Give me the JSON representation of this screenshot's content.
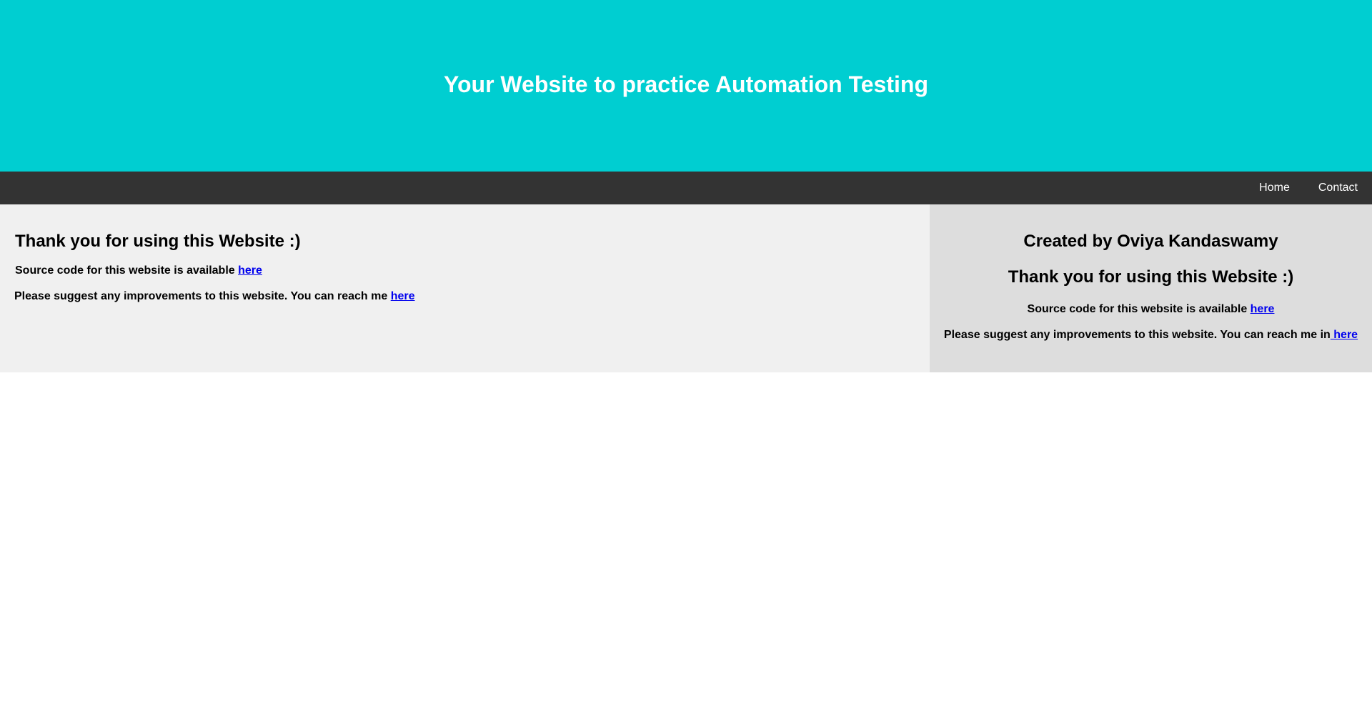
{
  "header": {
    "title": "Your Website to practice Automation Testing"
  },
  "nav": {
    "items": [
      {
        "label": "Home"
      },
      {
        "label": "Contact"
      }
    ]
  },
  "main": {
    "heading": "Thank you for using this Website :)",
    "source_text": "Source code for this website is available ",
    "source_link": "here",
    "suggest_text": "Please suggest any improvements to this website. You can reach me ",
    "suggest_link": "here"
  },
  "side": {
    "creator": "Created by Oviya Kandaswamy",
    "heading": "Thank you for using this Website :)",
    "source_text": "Source code for this website is available ",
    "source_link": "here",
    "suggest_text": "Please suggest any improvements to this website. You can reach me in",
    "suggest_link": " here"
  },
  "colors": {
    "header_bg": "#00ced1",
    "nav_bg": "#333333",
    "main_bg": "#f0f0f0",
    "side_bg": "#dddddd",
    "link": "#0000ee"
  }
}
